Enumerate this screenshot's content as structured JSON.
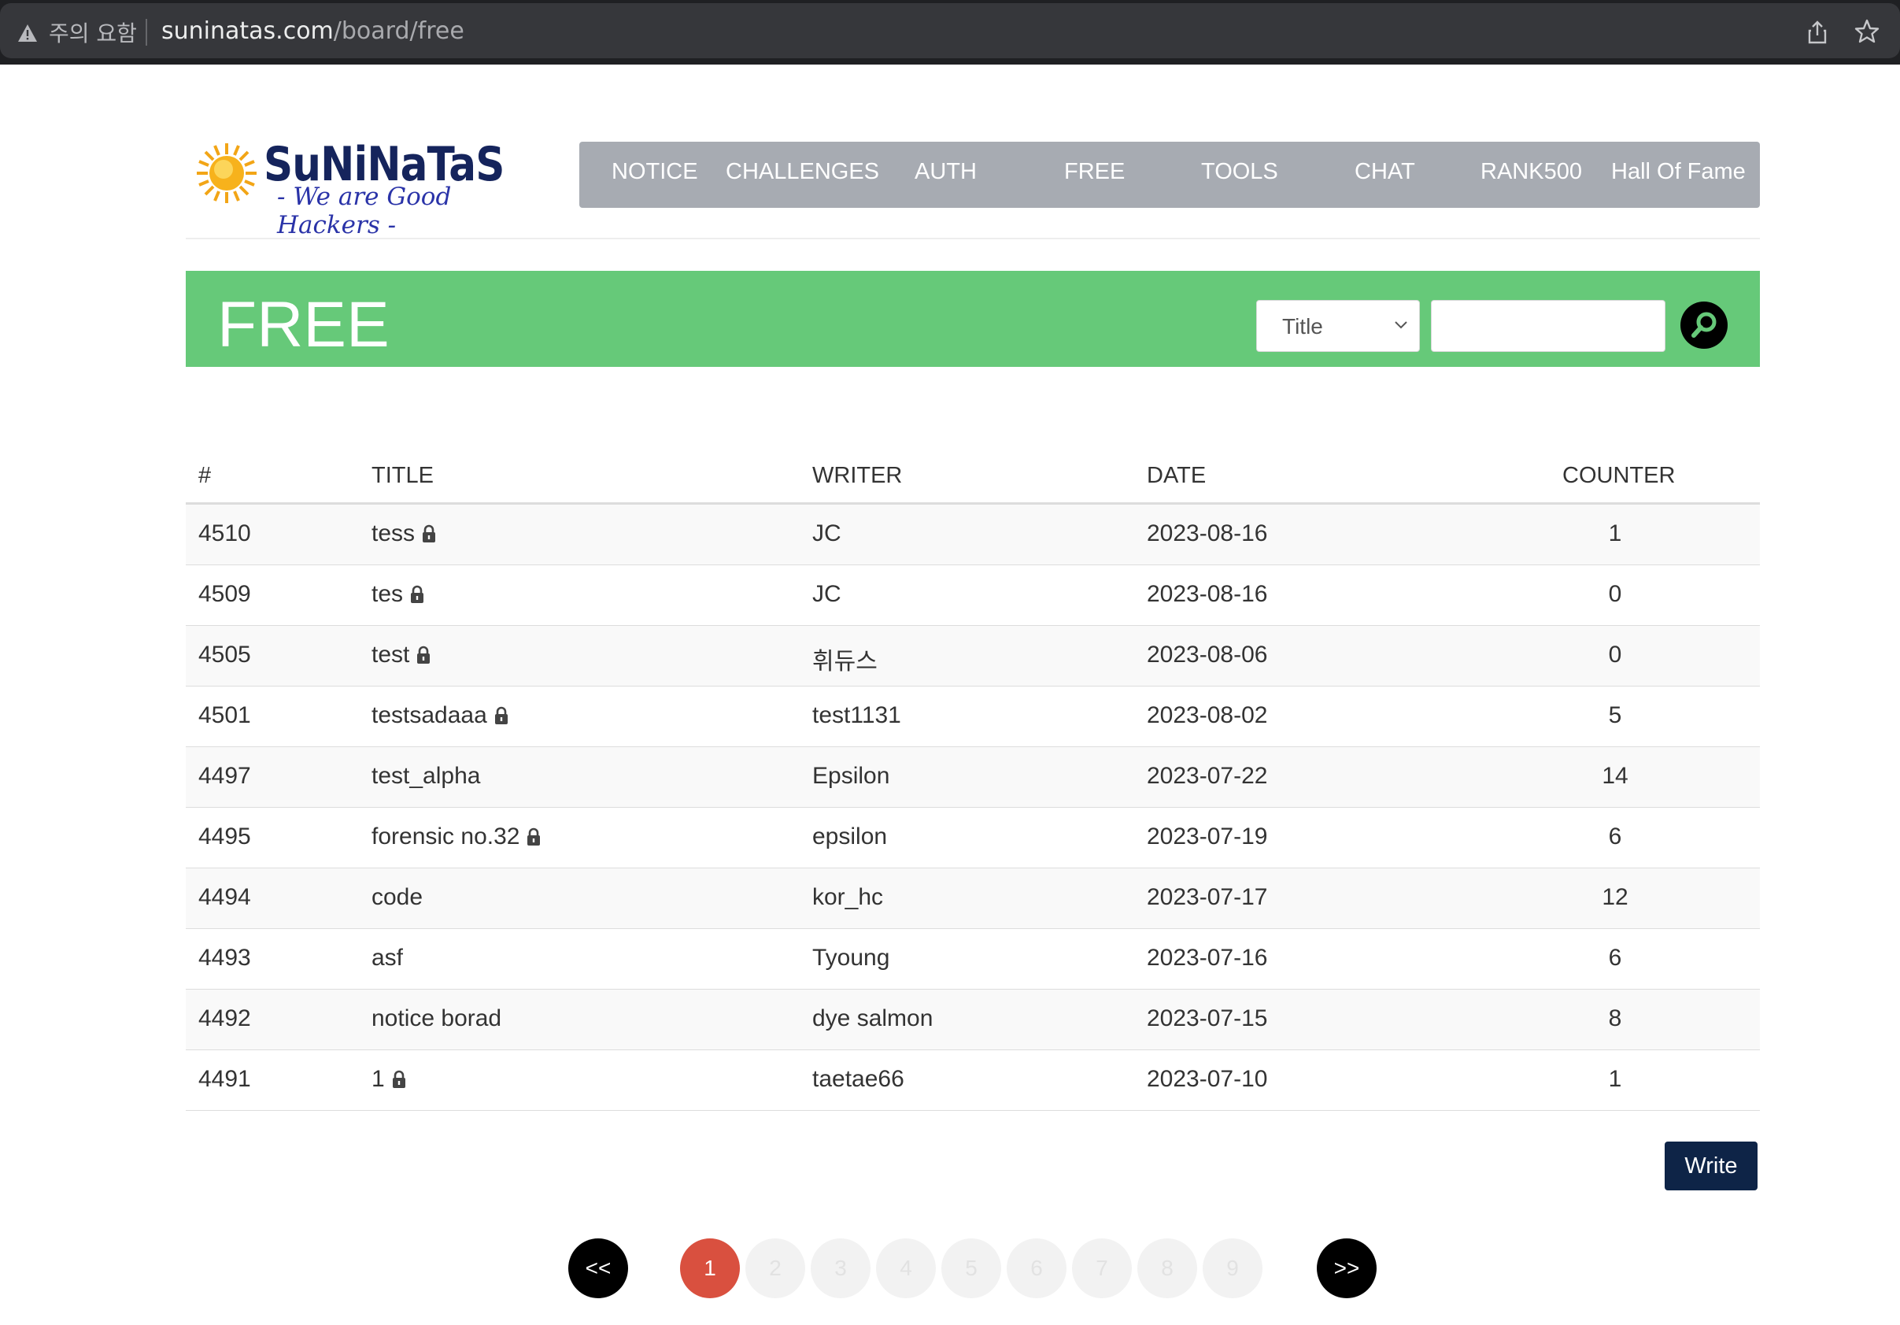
{
  "browser": {
    "warning_text": "주의 요함",
    "url_host": "suninatas.com",
    "url_path": "/board/free"
  },
  "logo": {
    "title": "SuNiNaTaS",
    "slogan": "- We are Good Hackers -"
  },
  "nav": {
    "items": [
      "NOTICE",
      "CHALLENGES",
      "AUTH",
      "FREE",
      "TOOLS",
      "CHAT",
      "RANK500",
      "Hall Of Fame"
    ]
  },
  "banner": {
    "title": "FREE",
    "search_field_selected": "Title",
    "search_value": ""
  },
  "table": {
    "headers": [
      "#",
      "TITLE",
      "WRITER",
      "DATE",
      "COUNTER"
    ],
    "rows": [
      {
        "num": "4510",
        "title": "tess",
        "locked": true,
        "writer": "JC",
        "date": "2023-08-16",
        "counter": "1"
      },
      {
        "num": "4509",
        "title": "tes",
        "locked": true,
        "writer": "JC",
        "date": "2023-08-16",
        "counter": "0"
      },
      {
        "num": "4505",
        "title": "test",
        "locked": true,
        "writer": "휘듀스",
        "date": "2023-08-06",
        "counter": "0"
      },
      {
        "num": "4501",
        "title": "testsadaaa",
        "locked": true,
        "writer": "test1131",
        "date": "2023-08-02",
        "counter": "5"
      },
      {
        "num": "4497",
        "title": "test_alpha",
        "locked": false,
        "writer": "Epsilon",
        "date": "2023-07-22",
        "counter": "14"
      },
      {
        "num": "4495",
        "title": "forensic no.32",
        "locked": true,
        "writer": "epsilon",
        "date": "2023-07-19",
        "counter": "6"
      },
      {
        "num": "4494",
        "title": "code",
        "locked": false,
        "writer": "kor_hc",
        "date": "2023-07-17",
        "counter": "12"
      },
      {
        "num": "4493",
        "title": "asf",
        "locked": false,
        "writer": "Tyoung",
        "date": "2023-07-16",
        "counter": "6"
      },
      {
        "num": "4492",
        "title": "notice borad",
        "locked": false,
        "writer": "dye salmon",
        "date": "2023-07-15",
        "counter": "8"
      },
      {
        "num": "4491",
        "title": "1",
        "locked": true,
        "writer": "taetae66",
        "date": "2023-07-10",
        "counter": "1"
      }
    ]
  },
  "write_label": "Write",
  "pagination": {
    "prev": "<<",
    "next": ">>",
    "pages": [
      "1",
      "2",
      "3",
      "4",
      "5",
      "6",
      "7",
      "8",
      "9"
    ],
    "current": "1"
  },
  "colors": {
    "banner_green": "#66c979",
    "nav_gray": "#a7abb2",
    "active_page": "#d9503f",
    "write_button": "#0e2447"
  }
}
